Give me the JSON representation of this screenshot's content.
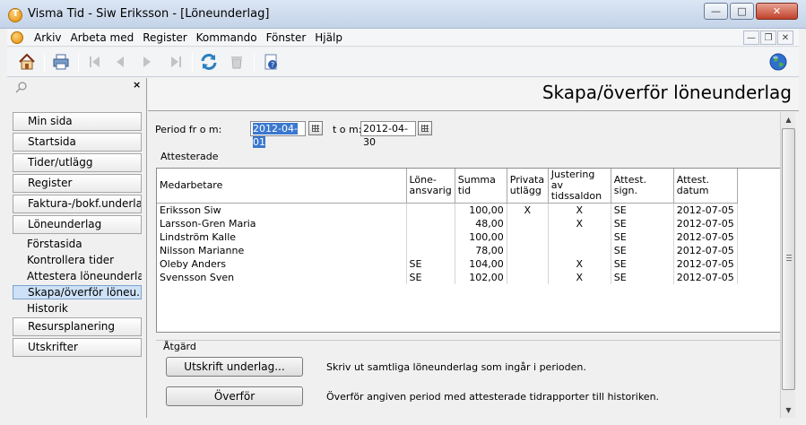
{
  "window": {
    "title": "Visma Tid - Siw Eriksson - [Löneunderlag]",
    "app_icon_letter": "T"
  },
  "menu": [
    "Arkiv",
    "Arbeta med",
    "Register",
    "Kommando",
    "Fönster",
    "Hjälp"
  ],
  "toolbar": [
    "home-icon",
    "print-icon",
    "first-icon",
    "prev-icon",
    "next-icon",
    "last-icon",
    "refresh-icon",
    "delete-icon",
    "help-icon",
    "globe-icon"
  ],
  "nav": {
    "sections": [
      "Min sida",
      "Startsida",
      "Tider/utlägg",
      "Register",
      "Faktura-/bokf.underlag",
      "Löneunderlag"
    ],
    "sub_items": [
      "Förstasida",
      "Kontrollera tider",
      "Attestera löneunderlag",
      "Skapa/överför löneu...",
      "Historik"
    ],
    "after": [
      "Resursplanering",
      "Utskrifter"
    ]
  },
  "page": {
    "heading": "Skapa/överför löneunderlag",
    "period_label": "Period fr o m:",
    "period_from": "2012-04-01",
    "to_label": "t o m:",
    "period_to": "2012-04-30",
    "group_label": "Attesterade"
  },
  "table": {
    "columns": [
      "Medarbetare",
      "Löne-\nansvarig",
      "Summa tid",
      "Privata\nutlägg",
      "Justering av\ntidssaldon",
      "Attest. sign.",
      "Attest.\ndatum"
    ],
    "rows": [
      [
        "Eriksson Siw",
        "",
        "100,00",
        "X",
        "X",
        "SE",
        "2012-07-05"
      ],
      [
        "Larsson-Gren Maria",
        "",
        "48,00",
        "",
        "X",
        "SE",
        "2012-07-05"
      ],
      [
        "Lindström Kalle",
        "",
        "100,00",
        "",
        "",
        "SE",
        "2012-07-05"
      ],
      [
        "Nilsson Marianne",
        "",
        "78,00",
        "",
        "",
        "SE",
        "2012-07-05"
      ],
      [
        "Oleby Anders",
        "SE",
        "104,00",
        "",
        "X",
        "SE",
        "2012-07-05"
      ],
      [
        "Svensson Sven",
        "SE",
        "102,00",
        "",
        "X",
        "SE",
        "2012-07-05"
      ]
    ]
  },
  "actions": {
    "label": "Åtgärd",
    "print_button": "Utskrift underlag...",
    "print_desc": "Skriv ut samtliga löneunderlag som ingår i perioden.",
    "transfer_button": "Överför",
    "transfer_desc": "Överför angiven period med attesterade tidrapporter till historiken."
  }
}
